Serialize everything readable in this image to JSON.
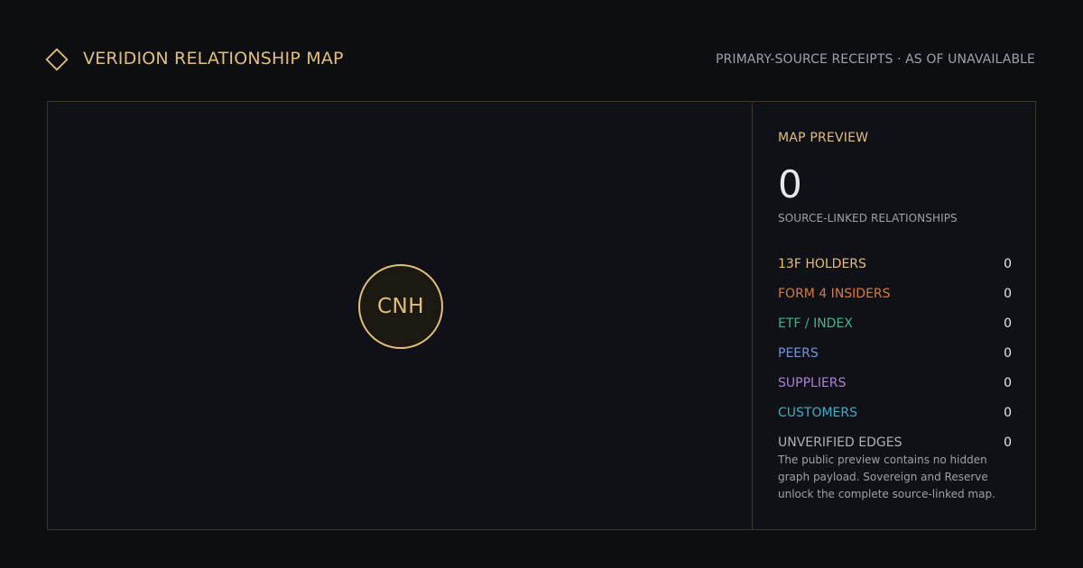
{
  "header": {
    "logo_icon": "diamond-outline-icon",
    "title": "VERIDION RELATIONSHIP MAP",
    "meta": "PRIMARY-SOURCE RECEIPTS · AS OF UNAVAILABLE"
  },
  "map": {
    "center_ticker": "CNH"
  },
  "panel": {
    "title": "MAP PREVIEW",
    "total_count": "0",
    "total_caption": "SOURCE-LINKED RELATIONSHIPS",
    "categories": [
      {
        "label": "13F HOLDERS",
        "value": "0",
        "color": "#e2bf7c"
      },
      {
        "label": "FORM 4 INSIDERS",
        "value": "0",
        "color": "#d47a48"
      },
      {
        "label": "ETF / INDEX",
        "value": "0",
        "color": "#3fb58a"
      },
      {
        "label": "PEERS",
        "value": "0",
        "color": "#6f95e0"
      },
      {
        "label": "SUPPLIERS",
        "value": "0",
        "color": "#b07fd8"
      },
      {
        "label": "CUSTOMERS",
        "value": "0",
        "color": "#46a9c4"
      },
      {
        "label": "UNVERIFIED EDGES",
        "value": "0",
        "color": "#aeb1b6"
      }
    ],
    "note": "The public preview contains no hidden graph payload. Sovereign and Reserve unlock the complete source-linked map."
  },
  "colors": {
    "background": "#0c0e12",
    "panel_background": "#0f1116",
    "accent_gold": "#e2bf7c",
    "border": "#3a3729",
    "muted_text": "#9ea1a6"
  }
}
